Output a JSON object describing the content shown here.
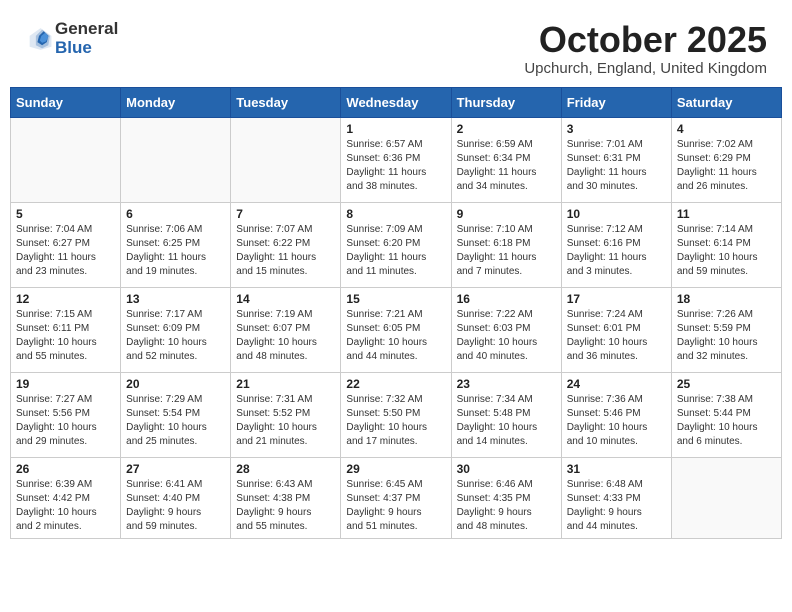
{
  "header": {
    "logo_line1": "General",
    "logo_line2": "Blue",
    "month": "October 2025",
    "location": "Upchurch, England, United Kingdom"
  },
  "days_of_week": [
    "Sunday",
    "Monday",
    "Tuesday",
    "Wednesday",
    "Thursday",
    "Friday",
    "Saturday"
  ],
  "weeks": [
    [
      {
        "day": "",
        "info": ""
      },
      {
        "day": "",
        "info": ""
      },
      {
        "day": "",
        "info": ""
      },
      {
        "day": "1",
        "info": "Sunrise: 6:57 AM\nSunset: 6:36 PM\nDaylight: 11 hours\nand 38 minutes."
      },
      {
        "day": "2",
        "info": "Sunrise: 6:59 AM\nSunset: 6:34 PM\nDaylight: 11 hours\nand 34 minutes."
      },
      {
        "day": "3",
        "info": "Sunrise: 7:01 AM\nSunset: 6:31 PM\nDaylight: 11 hours\nand 30 minutes."
      },
      {
        "day": "4",
        "info": "Sunrise: 7:02 AM\nSunset: 6:29 PM\nDaylight: 11 hours\nand 26 minutes."
      }
    ],
    [
      {
        "day": "5",
        "info": "Sunrise: 7:04 AM\nSunset: 6:27 PM\nDaylight: 11 hours\nand 23 minutes."
      },
      {
        "day": "6",
        "info": "Sunrise: 7:06 AM\nSunset: 6:25 PM\nDaylight: 11 hours\nand 19 minutes."
      },
      {
        "day": "7",
        "info": "Sunrise: 7:07 AM\nSunset: 6:22 PM\nDaylight: 11 hours\nand 15 minutes."
      },
      {
        "day": "8",
        "info": "Sunrise: 7:09 AM\nSunset: 6:20 PM\nDaylight: 11 hours\nand 11 minutes."
      },
      {
        "day": "9",
        "info": "Sunrise: 7:10 AM\nSunset: 6:18 PM\nDaylight: 11 hours\nand 7 minutes."
      },
      {
        "day": "10",
        "info": "Sunrise: 7:12 AM\nSunset: 6:16 PM\nDaylight: 11 hours\nand 3 minutes."
      },
      {
        "day": "11",
        "info": "Sunrise: 7:14 AM\nSunset: 6:14 PM\nDaylight: 10 hours\nand 59 minutes."
      }
    ],
    [
      {
        "day": "12",
        "info": "Sunrise: 7:15 AM\nSunset: 6:11 PM\nDaylight: 10 hours\nand 55 minutes."
      },
      {
        "day": "13",
        "info": "Sunrise: 7:17 AM\nSunset: 6:09 PM\nDaylight: 10 hours\nand 52 minutes."
      },
      {
        "day": "14",
        "info": "Sunrise: 7:19 AM\nSunset: 6:07 PM\nDaylight: 10 hours\nand 48 minutes."
      },
      {
        "day": "15",
        "info": "Sunrise: 7:21 AM\nSunset: 6:05 PM\nDaylight: 10 hours\nand 44 minutes."
      },
      {
        "day": "16",
        "info": "Sunrise: 7:22 AM\nSunset: 6:03 PM\nDaylight: 10 hours\nand 40 minutes."
      },
      {
        "day": "17",
        "info": "Sunrise: 7:24 AM\nSunset: 6:01 PM\nDaylight: 10 hours\nand 36 minutes."
      },
      {
        "day": "18",
        "info": "Sunrise: 7:26 AM\nSunset: 5:59 PM\nDaylight: 10 hours\nand 32 minutes."
      }
    ],
    [
      {
        "day": "19",
        "info": "Sunrise: 7:27 AM\nSunset: 5:56 PM\nDaylight: 10 hours\nand 29 minutes."
      },
      {
        "day": "20",
        "info": "Sunrise: 7:29 AM\nSunset: 5:54 PM\nDaylight: 10 hours\nand 25 minutes."
      },
      {
        "day": "21",
        "info": "Sunrise: 7:31 AM\nSunset: 5:52 PM\nDaylight: 10 hours\nand 21 minutes."
      },
      {
        "day": "22",
        "info": "Sunrise: 7:32 AM\nSunset: 5:50 PM\nDaylight: 10 hours\nand 17 minutes."
      },
      {
        "day": "23",
        "info": "Sunrise: 7:34 AM\nSunset: 5:48 PM\nDaylight: 10 hours\nand 14 minutes."
      },
      {
        "day": "24",
        "info": "Sunrise: 7:36 AM\nSunset: 5:46 PM\nDaylight: 10 hours\nand 10 minutes."
      },
      {
        "day": "25",
        "info": "Sunrise: 7:38 AM\nSunset: 5:44 PM\nDaylight: 10 hours\nand 6 minutes."
      }
    ],
    [
      {
        "day": "26",
        "info": "Sunrise: 6:39 AM\nSunset: 4:42 PM\nDaylight: 10 hours\nand 2 minutes."
      },
      {
        "day": "27",
        "info": "Sunrise: 6:41 AM\nSunset: 4:40 PM\nDaylight: 9 hours\nand 59 minutes."
      },
      {
        "day": "28",
        "info": "Sunrise: 6:43 AM\nSunset: 4:38 PM\nDaylight: 9 hours\nand 55 minutes."
      },
      {
        "day": "29",
        "info": "Sunrise: 6:45 AM\nSunset: 4:37 PM\nDaylight: 9 hours\nand 51 minutes."
      },
      {
        "day": "30",
        "info": "Sunrise: 6:46 AM\nSunset: 4:35 PM\nDaylight: 9 hours\nand 48 minutes."
      },
      {
        "day": "31",
        "info": "Sunrise: 6:48 AM\nSunset: 4:33 PM\nDaylight: 9 hours\nand 44 minutes."
      },
      {
        "day": "",
        "info": ""
      }
    ]
  ]
}
